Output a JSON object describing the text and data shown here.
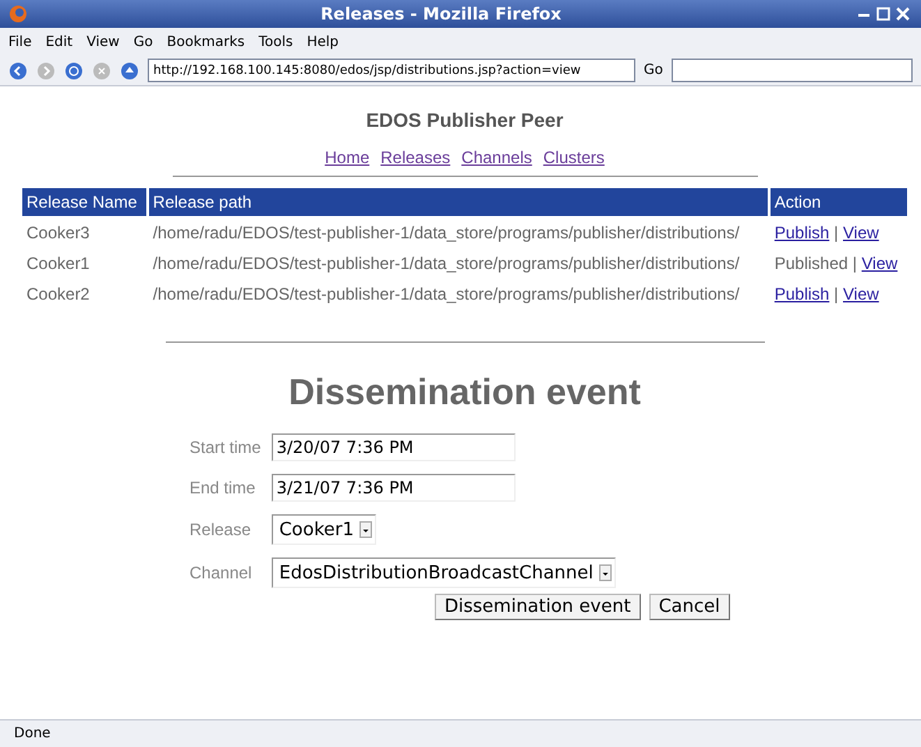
{
  "window": {
    "title": "Releases - Mozilla Firefox"
  },
  "menu": [
    "File",
    "Edit",
    "View",
    "Go",
    "Bookmarks",
    "Tools",
    "Help"
  ],
  "address": {
    "value": "http://192.168.100.145:8080/edos/jsp/distributions.jsp?action=view",
    "go": "Go"
  },
  "heading": "EDOS Publisher Peer",
  "nav": [
    "Home",
    "Releases",
    "Channels",
    "Clusters"
  ],
  "table": {
    "columns": [
      "Release Name",
      "Release path",
      "Action"
    ],
    "action_separator": "|",
    "rows": [
      {
        "name": "Cooker3",
        "path": "/home/radu/EDOS/test-publisher-1/data_store/programs/publisher/distributions/",
        "published": false,
        "action": "Publish",
        "view": "View"
      },
      {
        "name": "Cooker1",
        "path": "/home/radu/EDOS/test-publisher-1/data_store/programs/publisher/distributions/",
        "published": true,
        "action": "Published",
        "view": "View"
      },
      {
        "name": "Cooker2",
        "path": "/home/radu/EDOS/test-publisher-1/data_store/programs/publisher/distributions/",
        "published": false,
        "action": "Publish",
        "view": "View"
      }
    ]
  },
  "form": {
    "title": "Dissemination event",
    "fields": [
      {
        "kind": "text",
        "label": "Start time",
        "value": "3/20/07 7:36 PM"
      },
      {
        "kind": "text",
        "label": "End time",
        "value": "3/21/07 7:36 PM"
      },
      {
        "kind": "select",
        "label": "Release",
        "value": "Cooker1"
      },
      {
        "kind": "select",
        "label": "Channel",
        "value": "EdosDistributionBroadcastChannel"
      }
    ],
    "buttons": [
      "Dissemination event",
      "Cancel"
    ]
  },
  "status_bar": "Done"
}
